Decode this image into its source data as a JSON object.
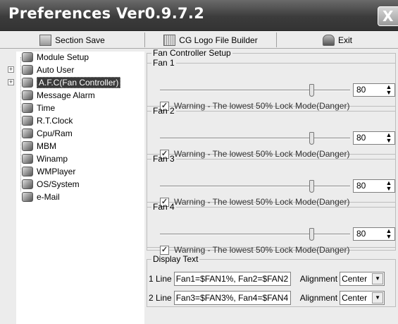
{
  "window": {
    "title": "Preferences Ver0.9.7.2",
    "close_label": "X"
  },
  "toolbar": {
    "section_save": "Section Save",
    "cg_logo": "CG Logo File Builder",
    "exit": "Exit"
  },
  "tree": {
    "items": [
      {
        "label": "Module Setup",
        "icon": "module-icon"
      },
      {
        "label": "Auto User",
        "icon": "auto-user-icon"
      },
      {
        "label": "A.F.C(Fan Controller)",
        "icon": "fan-icon"
      },
      {
        "label": "Message Alarm",
        "icon": "alarm-icon"
      },
      {
        "label": "Time",
        "icon": "time-icon"
      },
      {
        "label": "R.T.Clock",
        "icon": "clock-icon"
      },
      {
        "label": "Cpu/Ram",
        "icon": "cpu-icon"
      },
      {
        "label": "MBM",
        "icon": "mbm-icon"
      },
      {
        "label": "Winamp",
        "icon": "winamp-icon"
      },
      {
        "label": "WMPlayer",
        "icon": "wmplayer-icon"
      },
      {
        "label": "OS/System",
        "icon": "os-icon"
      },
      {
        "label": "e-Mail",
        "icon": "mail-icon"
      }
    ],
    "expander": "+"
  },
  "fan_setup": {
    "title": "Fan Controller Setup",
    "fans": [
      {
        "label": "Fan 1",
        "value": "80",
        "level": 0.8,
        "warning": "Warning - The lowest 50% Lock Mode(Danger)",
        "checked": true
      },
      {
        "label": "Fan 2",
        "value": "80",
        "level": 0.8,
        "warning": "Warning - The lowest 50% Lock Mode(Danger)",
        "checked": true
      },
      {
        "label": "Fan 3",
        "value": "80",
        "level": 0.8,
        "warning": "Warning - The lowest 50% Lock Mode(Danger)",
        "checked": true
      },
      {
        "label": "Fan 4",
        "value": "80",
        "level": 0.8,
        "warning": "Warning - The lowest 50% Lock Mode(Danger)",
        "checked": true
      }
    ]
  },
  "display_text": {
    "title": "Display Text",
    "line1": {
      "label": "1 Line",
      "value": "Fan1=$FAN1%, Fan2=$FAN2",
      "alignment_label": "Alignment",
      "alignment": "Center"
    },
    "line2": {
      "label": "2 Line",
      "value": "Fan3=$FAN3%, Fan4=$FAN4",
      "alignment_label": "Alignment",
      "alignment": "Center"
    }
  }
}
